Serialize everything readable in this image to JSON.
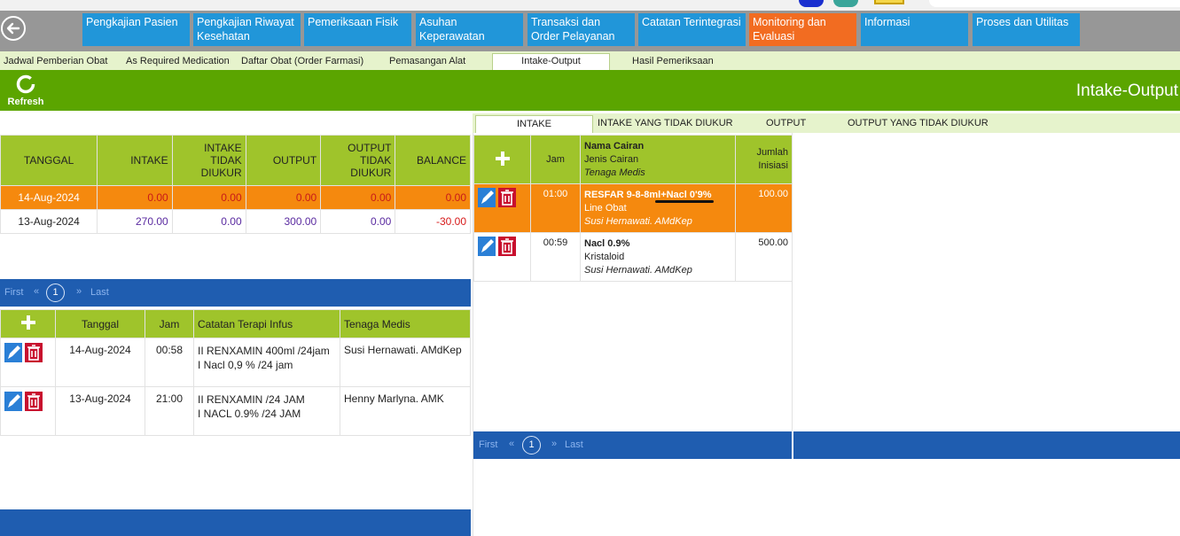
{
  "nav": {
    "items": [
      {
        "label": "Pengkajian Pasien"
      },
      {
        "label": "Pengkajian Riwayat Kesehatan"
      },
      {
        "label": "Pemeriksaan Fisik"
      },
      {
        "label": "Asuhan Keperawatan"
      },
      {
        "label": "Transaksi dan Order Pelayanan"
      },
      {
        "label": "Catatan Terintegrasi"
      },
      {
        "label": "Monitoring dan Evaluasi"
      },
      {
        "label": "Informasi"
      },
      {
        "label": "Proses dan Utilitas"
      }
    ],
    "active": "Monitoring dan Evaluasi"
  },
  "subtabs": {
    "items": [
      "Jadwal Pemberian Obat",
      "As Required Medication",
      "Daftar Obat (Order Farmasi)",
      "Pemasangan Alat",
      "Intake-Output",
      "Hasil Pemeriksaan"
    ],
    "active": "Intake-Output"
  },
  "toolbar": {
    "refresh_label": "Refresh",
    "page_title": "Intake-Output"
  },
  "summary": {
    "headers": [
      "TANGGAL",
      "INTAKE",
      "INTAKE TIDAK DIUKUR",
      "OUTPUT",
      "OUTPUT TIDAK DIUKUR",
      "BALANCE"
    ],
    "rows": [
      {
        "tanggal": "14-Aug-2024",
        "intake": "0.00",
        "intake_tidak": "0.00",
        "output": "0.00",
        "output_tidak": "0.00",
        "balance": "0.00"
      },
      {
        "tanggal": "13-Aug-2024",
        "intake": "270.00",
        "intake_tidak": "0.00",
        "output": "300.00",
        "output_tidak": "0.00",
        "balance": "-30.00"
      }
    ]
  },
  "pager": {
    "first": "First",
    "prev": "«",
    "page": "1",
    "next": "»",
    "last": "Last"
  },
  "infus": {
    "headers": [
      "Tanggal",
      "Jam",
      "Catatan Terapi Infus",
      "Tenaga Medis"
    ],
    "rows": [
      {
        "tanggal": "14-Aug-2024",
        "jam": "00:58",
        "catatan1": "II RENXAMIN 400ml /24jam",
        "catatan2": "I Nacl 0,9 % /24 jam",
        "tenaga": "Susi Hernawati. AMdKep"
      },
      {
        "tanggal": "13-Aug-2024",
        "jam": "21:00",
        "catatan1": "II RENXAMIN /24 JAM",
        "catatan2": "I NACL 0.9% /24 JAM",
        "tenaga": "Henny Marlyna. AMK"
      }
    ]
  },
  "right_tabs": {
    "items": [
      "INTAKE",
      "INTAKE YANG TIDAK DIUKUR",
      "OUTPUT",
      "OUTPUT YANG TIDAK DIUKUR"
    ],
    "active": "INTAKE"
  },
  "intake": {
    "headers": {
      "jam": "Jam",
      "nama": "Nama Cairan",
      "jenis": "Jenis Cairan",
      "tenaga": "Tenaga Medis",
      "jumlah1": "Jumlah",
      "jumlah2": "Inisiasi"
    },
    "rows": [
      {
        "jam": "01:00",
        "nama": "RESFAR 9-8-8ml+Nacl 0'9%",
        "jenis": "Line Obat",
        "tenaga": "Susi Hernawati. AMdKep",
        "jumlah": "100.00"
      },
      {
        "jam": "00:59",
        "nama": "Nacl 0.9%",
        "jenis": "Kristaloid",
        "tenaga": "Susi Hernawati. AMdKep",
        "jumlah": "500.00"
      }
    ]
  },
  "colors": {
    "nav_blue": "#2196d9",
    "nav_active": "#f26c21",
    "green": "#5ba500",
    "header_green": "#9fc42b",
    "row_highlight": "#f5890e",
    "pager_blue": "#1f5db0"
  }
}
